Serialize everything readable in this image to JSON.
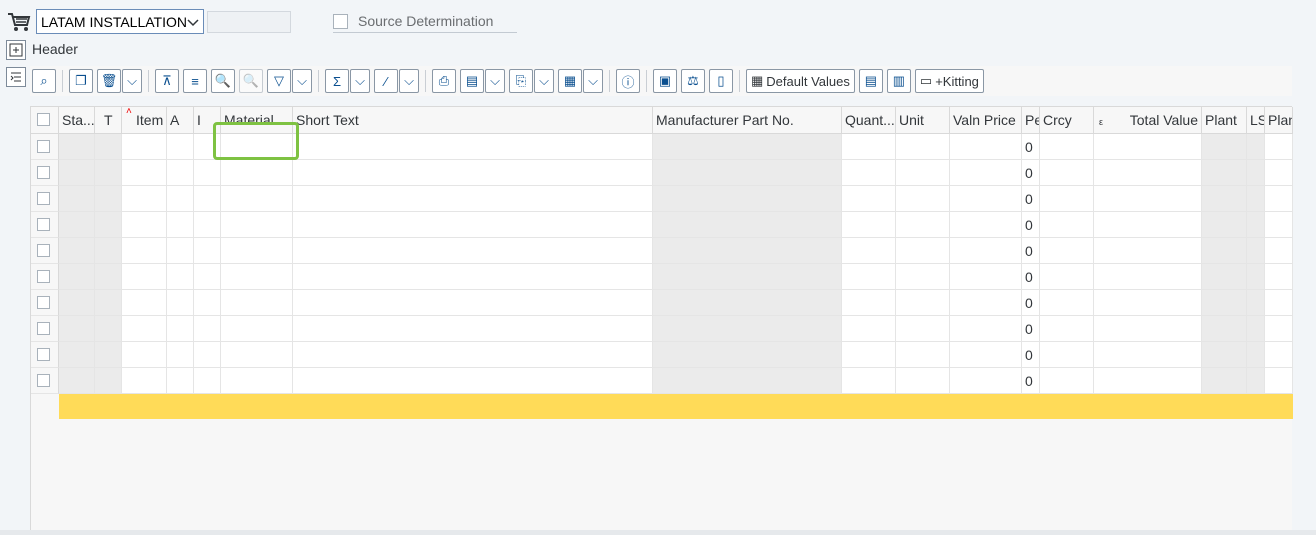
{
  "top": {
    "document_type": "LATAM INSTALLATION",
    "document_type_extra": "",
    "source_determination_label": "Source Determination",
    "header_label": "Header"
  },
  "toolbar": {
    "default_values_label": "Default Values",
    "kitting_label": "+Kitting"
  },
  "table": {
    "columns": [
      "Sta...",
      "T",
      "Item",
      "A",
      "I",
      "Material",
      "Short Text",
      "Manufacturer Part No.",
      "Quant...",
      "Unit",
      "Valn Price",
      "Pe",
      "Crcy",
      "Total Value",
      "Plant",
      "LS",
      "Plan"
    ],
    "rows": [
      {
        "material": "",
        "per": "0"
      },
      {
        "material": "",
        "per": "0"
      },
      {
        "material": "",
        "per": "0"
      },
      {
        "material": "",
        "per": "0"
      },
      {
        "material": "",
        "per": "0"
      },
      {
        "material": "",
        "per": "0"
      },
      {
        "material": "",
        "per": "0"
      },
      {
        "material": "",
        "per": "0"
      },
      {
        "material": "",
        "per": "0"
      },
      {
        "material": "",
        "per": "0"
      }
    ],
    "sum_marker": "ε"
  },
  "colors": {
    "accent": "#0a4f8f",
    "highlight": "#7ec242",
    "summary_row": "#ffdb58"
  },
  "icons": [
    "cart-icon",
    "expand-header-icon",
    "collapse-icon",
    "zoom-icon",
    "copy-icon",
    "delete-icon",
    "align-top-icon",
    "align-center-icon",
    "find-icon",
    "find-next-icon",
    "filter-icon",
    "sum-icon",
    "subtotal-icon",
    "print-icon",
    "preview-icon",
    "export-icon",
    "layout-icon",
    "info-icon",
    "details-icon",
    "balance-icon",
    "document-icon",
    "default-values-icon",
    "list-icon",
    "calc-icon",
    "kitting-icon"
  ]
}
